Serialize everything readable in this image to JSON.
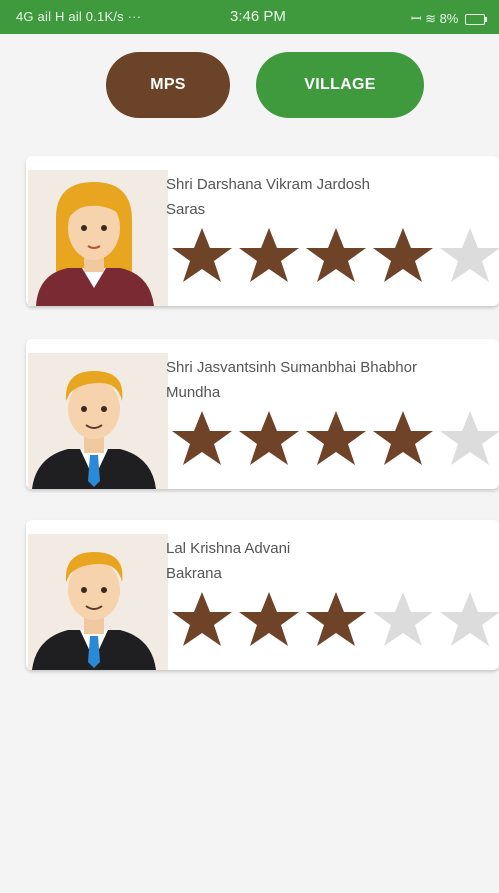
{
  "status_bar": {
    "left": "4G ail  H ail  0.1K/s ···",
    "time": "3:46 PM",
    "right": "ꟷ ≋ 8%",
    "battery_icon": "battery-icon"
  },
  "tabs": {
    "mps_label": "MPS",
    "village_label": "VILLAGE",
    "colors": {
      "mps": "#6b4328",
      "village": "#3f9a3d"
    }
  },
  "cards": [
    {
      "name": "Shri Darshana Vikram Jardosh",
      "village": "Saras",
      "rating": 4,
      "max": 5,
      "avatar": "female-avatar"
    },
    {
      "name": "Shri Jasvantsinh Sumanbhai Bhabhor",
      "village": "Mundha",
      "rating": 4,
      "max": 5,
      "avatar": "male-avatar"
    },
    {
      "name": "Lal Krishna Advani",
      "village": "Bakrana",
      "rating": 3,
      "max": 5,
      "avatar": "male-avatar"
    }
  ],
  "colors": {
    "star_on": "#6e4328",
    "star_off": "#dcdcdc",
    "card_bg": "#ffffff",
    "page_bg": "#f4f4f4"
  }
}
